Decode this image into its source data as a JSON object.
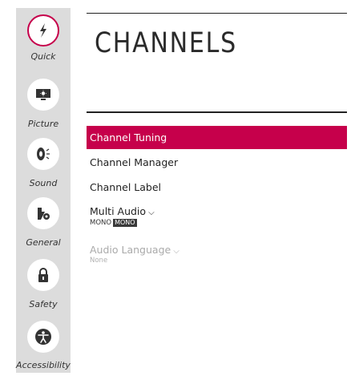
{
  "sidebar": {
    "items": [
      {
        "label": "Quick",
        "icon": "quick-settings-icon",
        "active": true
      },
      {
        "label": "Picture",
        "icon": "picture-icon"
      },
      {
        "label": "Sound",
        "icon": "sound-icon"
      },
      {
        "label": "General",
        "icon": "general-icon"
      },
      {
        "label": "Safety",
        "icon": "lock-icon"
      },
      {
        "label": "Accessibility",
        "icon": "accessibility-icon"
      }
    ]
  },
  "main": {
    "title": "CHANNELS",
    "menu": [
      {
        "label": "Channel Tuning",
        "selected": true
      },
      {
        "label": "Channel Manager"
      },
      {
        "label": "Channel Label"
      },
      {
        "label": "Multi Audio",
        "value": "MONO",
        "badge": "MONO",
        "has_dropdown": true
      },
      {
        "label": "Audio Language",
        "value": "None",
        "disabled": true,
        "has_dropdown": true
      }
    ]
  },
  "colors": {
    "accent": "#c6004b",
    "sidebar_bg": "#dcdcdc",
    "text": "#222222",
    "disabled_text": "#aaaaaa"
  }
}
